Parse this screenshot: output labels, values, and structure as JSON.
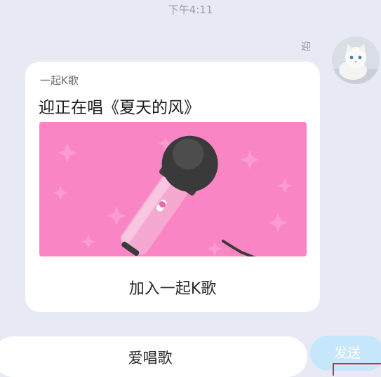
{
  "chat": {
    "timestamp": "下午4:11",
    "sender_name": "迎"
  },
  "music_card": {
    "source": "一起K歌",
    "title": "迎正在唱《夏天的风》",
    "action_label": "加入一起K歌",
    "banner_icon": "microphone-icon",
    "banner_color": "#f985c4"
  },
  "composer": {
    "input_value": "爱唱歌",
    "send_label": "发送",
    "send_color": "#c6e6fb"
  }
}
